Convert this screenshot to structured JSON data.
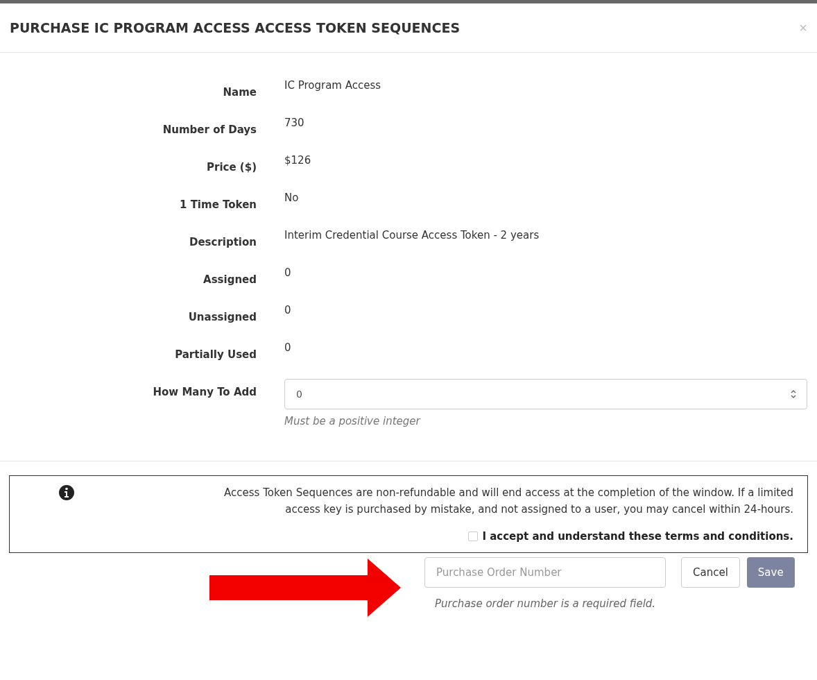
{
  "dialog": {
    "title": "PURCHASE IC PROGRAM ACCESS ACCESS TOKEN SEQUENCES",
    "close": "×"
  },
  "fields": [
    {
      "label": "Name",
      "value": "IC Program Access"
    },
    {
      "label": "Number of Days",
      "value": "730"
    },
    {
      "label": "Price ($)",
      "value": "$126"
    },
    {
      "label": "1 Time Token",
      "value": "No"
    },
    {
      "label": "Description",
      "value": "Interim Credential Course Access Token - 2 years"
    },
    {
      "label": "Assigned",
      "value": "0"
    },
    {
      "label": "Unassigned",
      "value": "0"
    },
    {
      "label": "Partially Used",
      "value": "0"
    }
  ],
  "quantity": {
    "label": "How Many To Add",
    "value": "0",
    "hint": "Must be a positive integer"
  },
  "notice": {
    "text": "Access Token Sequences are non-refundable and will end access at the completion of the window. If a limited access key is purchased by mistake, and not assigned to a user, you may cancel within 24-hours.",
    "terms": {
      "label": "I accept and understand these terms and conditions.",
      "checked": false
    }
  },
  "footer": {
    "po": {
      "placeholder": "Purchase Order Number",
      "error": "Purchase order number is a required field."
    },
    "cancel": "Cancel",
    "save": {
      "label": "Save",
      "disabled": true
    }
  }
}
